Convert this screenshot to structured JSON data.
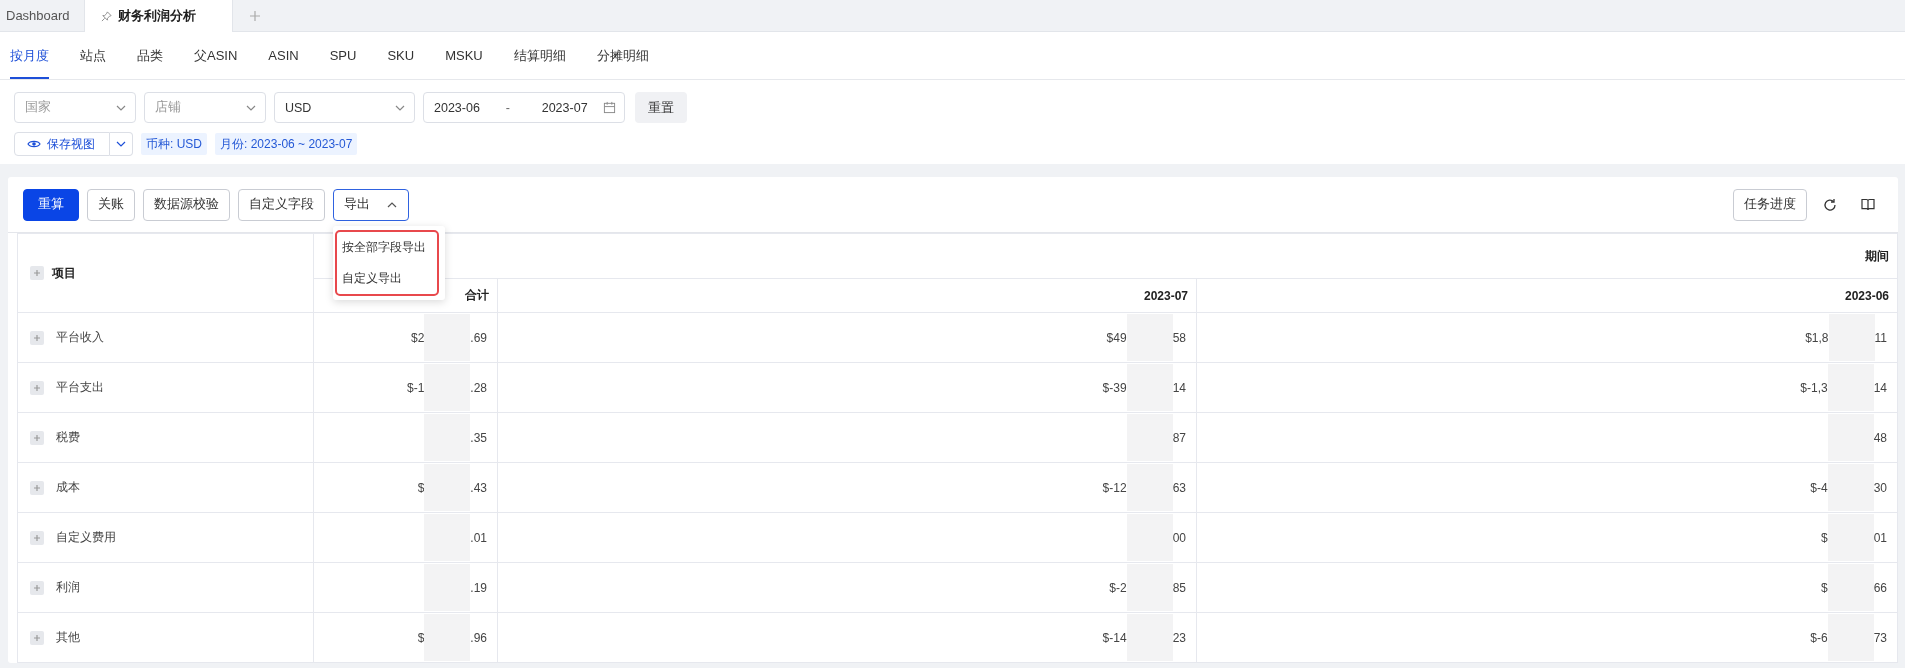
{
  "window_tabs": [
    {
      "label": "Dashboard",
      "selected": false,
      "pinned": false
    },
    {
      "label": "财务利润分析",
      "selected": true,
      "pinned": true
    }
  ],
  "view_tabs": [
    {
      "label": "按月度",
      "selected": true
    },
    {
      "label": "站点",
      "selected": false
    },
    {
      "label": "品类",
      "selected": false
    },
    {
      "label": "父ASIN",
      "selected": false
    },
    {
      "label": "ASIN",
      "selected": false
    },
    {
      "label": "SPU",
      "selected": false
    },
    {
      "label": "SKU",
      "selected": false
    },
    {
      "label": "MSKU",
      "selected": false
    },
    {
      "label": "结算明细",
      "selected": false
    },
    {
      "label": "分摊明细",
      "selected": false
    }
  ],
  "filters": {
    "selects": [
      {
        "placeholder": "国家"
      },
      {
        "placeholder": "店铺"
      },
      {
        "value": "USD"
      }
    ],
    "date_range": {
      "start": "2023-06",
      "separator": "-",
      "end": "2023-07"
    },
    "reset_button": "重置"
  },
  "saved_view": {
    "button": "保存视图",
    "tags": [
      "币种: USD",
      "月份: 2023-06 ~ 2023-07"
    ]
  },
  "toolbar": {
    "buttons": [
      {
        "label": "重算",
        "kind": "primary"
      },
      {
        "label": "关账",
        "kind": "default"
      },
      {
        "label": "数据源校验",
        "kind": "default"
      },
      {
        "label": "自定义字段",
        "kind": "default"
      },
      {
        "label": "导出",
        "kind": "dropdown",
        "expanded": true
      }
    ],
    "right_button": "任务进度"
  },
  "export_menu": {
    "items": [
      "按全部字段导出",
      "自定义导出"
    ],
    "highlighted": true
  },
  "table": {
    "item_header": {
      "label": "项目",
      "expanded": false
    },
    "group_header": "期间",
    "columns": [
      "合计",
      "2023-07",
      "2023-06"
    ],
    "rows": [
      {
        "name": "平台收入",
        "expanded": false,
        "cells": [
          {
            "start": "$2",
            "end": ".69"
          },
          {
            "start": "$49",
            "end": "58"
          },
          {
            "start": "$1,8",
            "end": "11"
          }
        ]
      },
      {
        "name": "平台支出",
        "expanded": false,
        "cells": [
          {
            "start": "$-1",
            "end": ".28"
          },
          {
            "start": "$-39",
            "end": "14"
          },
          {
            "start": "$-1,3",
            "end": "14"
          }
        ]
      },
      {
        "name": "税费",
        "expanded": false,
        "cells": [
          {
            "end": ".35"
          },
          {
            "end": "87"
          },
          {
            "end": "48"
          }
        ]
      },
      {
        "name": "成本",
        "expanded": false,
        "cells": [
          {
            "start": "$",
            "end": ".43"
          },
          {
            "start": "$-12",
            "end": "63"
          },
          {
            "start": "$-4",
            "end": "30"
          }
        ]
      },
      {
        "name": "自定义费用",
        "expanded": false,
        "cells": [
          {
            "end": ".01"
          },
          {
            "end": "00"
          },
          {
            "start": "$",
            "end": "01"
          }
        ]
      },
      {
        "name": "利润",
        "expanded": false,
        "cells": [
          {
            "end": ".19"
          },
          {
            "start": "$-2",
            "end": "85"
          },
          {
            "start": "$",
            "end": "66"
          }
        ]
      },
      {
        "name": "其他",
        "expanded": false,
        "cells": [
          {
            "start": "$",
            "end": ".96"
          },
          {
            "start": "$-14",
            "end": "23"
          },
          {
            "start": "$-6",
            "end": "73"
          }
        ]
      }
    ]
  }
}
